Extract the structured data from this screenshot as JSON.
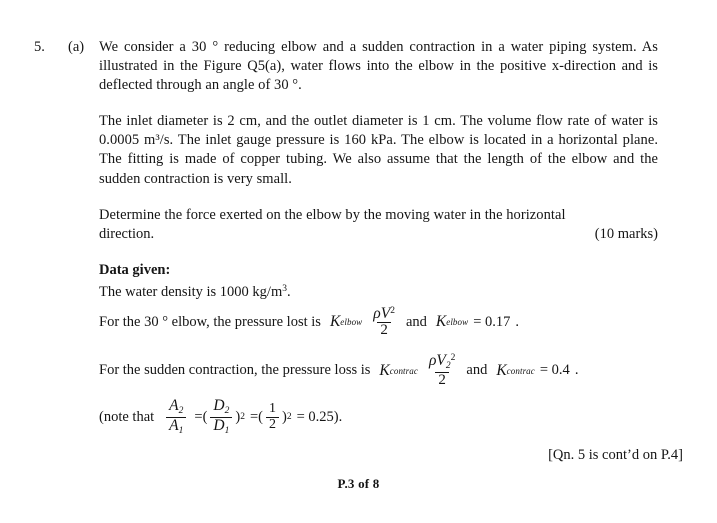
{
  "document": {
    "question_number": "5.",
    "part_label": "(a)",
    "paragraphs": [
      "We consider a 30 ° reducing elbow and a sudden contraction in a water piping system. As illustrated in the Figure Q5(a), water flows into the elbow in the positive x-direction and is deflected through an angle of 30 °.",
      "The inlet diameter is 2 cm, and the outlet diameter is 1 cm. The volume flow rate of water is 0.0005 m³/s. The inlet gauge pressure is 160 kPa. The elbow is located in a horizontal plane. The fitting is made of copper tubing. We also assume that the length of the elbow and the sudden contraction is very small."
    ],
    "determine_text": "Determine the force exerted on the elbow by the moving water in the horizontal",
    "determine_text_line2": "direction.",
    "marks": "(10 marks)",
    "data_given_heading": "Data given:",
    "water_density_line": "The water density is 1000 kg/m",
    "water_density_exponent": "3",
    "water_density_period": ".",
    "elbow_formula": {
      "lead": "For the 30 ° elbow, the pressure lost is",
      "k_symbol": "K",
      "k_subscript": "elbow",
      "numerator_rho": "ρ",
      "numerator_v": "V",
      "numerator_v_power": "2",
      "denominator": "2",
      "conjunction": "and",
      "k_symbol_2": "K",
      "k_subscript_2": "elbow",
      "equals_value": "= 0.17",
      "period": "."
    },
    "contraction_formula": {
      "lead": "For the sudden contraction, the pressure loss is",
      "k_symbol": "K",
      "k_subscript": "contrac",
      "numerator_rho": "ρ",
      "numerator_v": "V",
      "numerator_v_subscript": "2",
      "numerator_v_power": "2",
      "denominator": "2",
      "conjunction": "and",
      "k_symbol_2": "K",
      "k_subscript_2": "contrac",
      "equals_value": "= 0.4",
      "period": "."
    },
    "note_line": {
      "lead": "(note that",
      "frac1_num": "A",
      "frac1_num_sub": "2",
      "frac1_den": "A",
      "frac1_den_sub": "1",
      "eq1": "=",
      "paren_open": "(",
      "frac2_num": "D",
      "frac2_num_sub": "2",
      "frac2_den": "D",
      "frac2_den_sub": "1",
      "paren_close": ")",
      "power1": "2",
      "eq2": "=",
      "paren_open_2": "(",
      "frac3_num": "1",
      "frac3_den": "2",
      "paren_close_2": ")",
      "power2": "2",
      "eq3": "= 0.25",
      "tail": ")."
    },
    "continued_note": "[Qn. 5 is cont’d on P.4]",
    "page_footer": "P.3 of 8"
  }
}
